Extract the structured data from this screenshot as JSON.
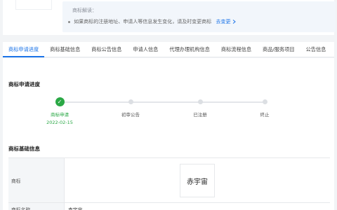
{
  "notice": {
    "title": "商标解读：",
    "line": "如果商标的注册地址、申请人等信息发生变化，请及时变更商标",
    "link": "去变更"
  },
  "tabs": [
    "商标申请进度",
    "商标基础信息",
    "商标公告信息",
    "申请人信息",
    "代理办理机构信息",
    "商标流程信息",
    "商品/服务项目",
    "公告信息"
  ],
  "progress": {
    "title": "商标申请进度",
    "steps": [
      {
        "label": "商标申请",
        "date": "2022-02-15",
        "done": true
      },
      {
        "label": "初审公告",
        "date": "",
        "done": false
      },
      {
        "label": "已注册",
        "date": "",
        "done": false
      },
      {
        "label": "终止",
        "date": "",
        "done": false
      }
    ]
  },
  "basic_info": {
    "title": "商标基础信息",
    "rows": [
      {
        "label": "商标",
        "logo_text": "赤宇宙"
      },
      {
        "label": "商标名称",
        "value": "赤宇宙"
      }
    ]
  }
}
